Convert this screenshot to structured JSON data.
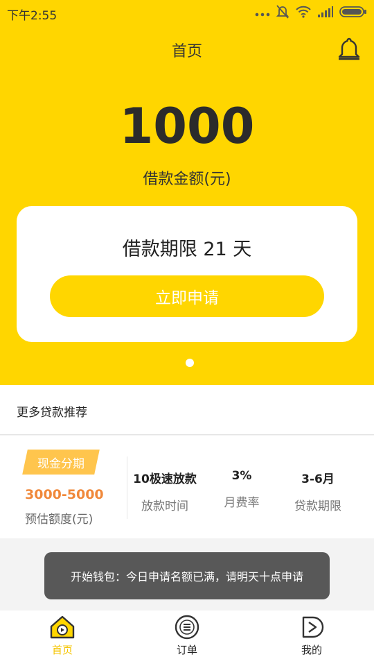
{
  "status_bar": {
    "time": "下午2:55"
  },
  "header": {
    "title": "首页"
  },
  "hero": {
    "amount": "1000",
    "amount_label": "借款金额(元)"
  },
  "card": {
    "term": "借款期限 21 天",
    "apply_label": "立即申请"
  },
  "recommend": {
    "title": "更多贷款推荐"
  },
  "product": {
    "tag": "现金分期",
    "range": "3000-5000",
    "range_label": "预估额度(元)",
    "stats": [
      {
        "value": "10极速放款",
        "label": "放款时间"
      },
      {
        "value": "3%",
        "label": "月费率"
      },
      {
        "value": "3-6月",
        "label": "贷款期限"
      }
    ]
  },
  "toast": {
    "message": "开始钱包：今日申请名额已满，请明天十点申请"
  },
  "tabbar": {
    "items": [
      {
        "label": "首页",
        "icon": "home-icon",
        "active": true
      },
      {
        "label": "订单",
        "icon": "orders-icon",
        "active": false
      },
      {
        "label": "我的",
        "icon": "profile-icon",
        "active": false
      }
    ]
  },
  "colors": {
    "brand": "#ffd600",
    "accent": "#f0883a",
    "tag": "#ffc54d",
    "active_tab": "#f5c400"
  }
}
